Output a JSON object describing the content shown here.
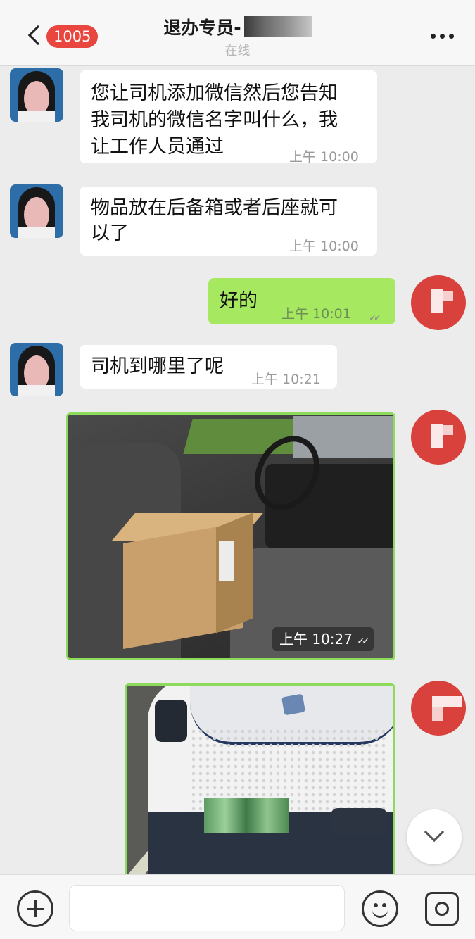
{
  "header": {
    "back_badge": "1005",
    "title": "退办专员-",
    "status": "在线"
  },
  "messages": [
    {
      "sender": "agent",
      "lines": [
        "您让司机添加微信然后您告知",
        "我司机的微信名字叫什么，我",
        "让工作人员通过"
      ],
      "time": "上午  10:00"
    },
    {
      "sender": "agent",
      "lines": [
        "物品放在后备箱或者后座就可",
        "以了"
      ],
      "time": "上午  10:00"
    },
    {
      "sender": "me",
      "lines": [
        "好的"
      ],
      "time": "上午  10:01",
      "read_mark": "✓✓"
    },
    {
      "sender": "agent",
      "lines": [
        "司机到哪里了呢"
      ],
      "time": "上午  10:21"
    },
    {
      "sender": "me",
      "type": "image",
      "time": "上午  10:27",
      "read_mark": "✓✓"
    },
    {
      "sender": "me",
      "type": "image"
    }
  ],
  "input": {
    "placeholder": ""
  },
  "colors": {
    "my_bubble": "#a6e860",
    "badge": "#e8463f",
    "photo_border": "#8ddb5c"
  },
  "icons": {
    "back": "chevron-left-icon",
    "more": "more-horizontal-icon",
    "plus": "plus-circle-icon",
    "emoji": "smiley-icon",
    "camera": "camera-icon",
    "scroll_down": "chevron-down-icon"
  }
}
